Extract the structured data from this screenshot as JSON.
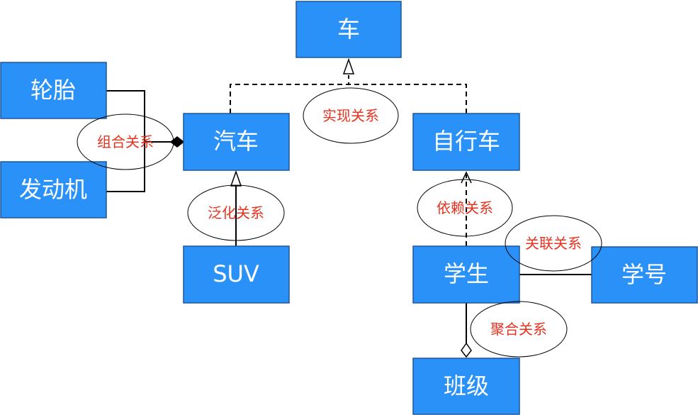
{
  "nodes": {
    "che": "车",
    "luntai": "轮胎",
    "fadongji": "发动机",
    "qiche": "汽车",
    "zixingche": "自行车",
    "suv": "SUV",
    "xuesheng": "学生",
    "xuehao": "学号",
    "banji": "班级"
  },
  "relations": {
    "realization": "实现关系",
    "composition": "组合关系",
    "generalization": "泛化关系",
    "dependency": "依赖关系",
    "association": "关联关系",
    "aggregation": "聚合关系"
  },
  "colors": {
    "node_fill": "#2991f7",
    "node_text": "#ffffff",
    "label_text": "#e8321e"
  }
}
